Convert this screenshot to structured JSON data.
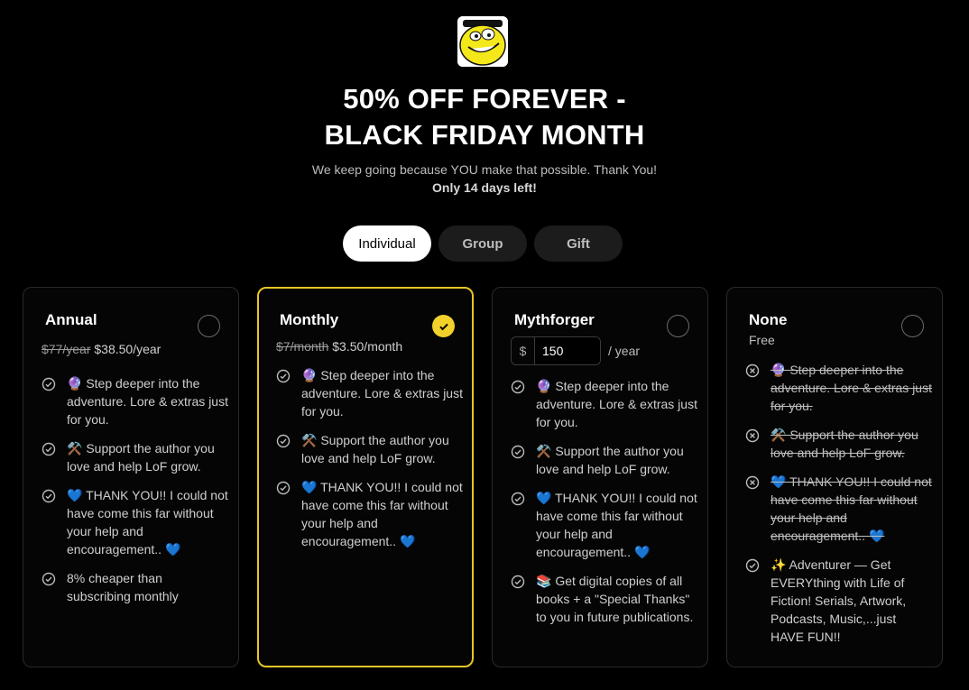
{
  "header": {
    "title_line1": "50% OFF FOREVER -",
    "title_line2": "BLACK FRIDAY MONTH",
    "subtitle": "We keep going because YOU make that possible. Thank You!",
    "urgency": "Only 14 days left!"
  },
  "tabs": [
    {
      "label": "Individual",
      "active": true
    },
    {
      "label": "Group",
      "active": false
    },
    {
      "label": "Gift",
      "active": false
    }
  ],
  "plans": {
    "annual": {
      "name": "Annual",
      "old_price": "$77/year",
      "price": "$38.50/year",
      "selected": false,
      "features": [
        "🔮 Step deeper into the adventure. Lore & extras just for you.",
        "⚒️ Support the author you love and help LoF grow.",
        "💙 THANK YOU!! I could not have come this far without your help and encouragement.. 💙",
        "8% cheaper than subscribing monthly"
      ]
    },
    "monthly": {
      "name": "Monthly",
      "old_price": "$7/month",
      "price": "$3.50/month",
      "selected": true,
      "features": [
        "🔮 Step deeper into the adventure. Lore & extras just for you.",
        "⚒️ Support the author you love and help LoF grow.",
        "💙 THANK YOU!! I could not have come this far without your help and encouragement.. 💙"
      ]
    },
    "mythforger": {
      "name": "Mythforger",
      "currency": "$",
      "amount": "150",
      "unit": "/ year",
      "selected": false,
      "features": [
        "🔮 Step deeper into the adventure. Lore & extras just for you.",
        "⚒️ Support the author you love and help LoF grow.",
        "💙 THANK YOU!! I could not have come this far without your help and encouragement.. 💙",
        "📚 Get digital copies of all books + a \"Special Thanks\" to you in future publications."
      ]
    },
    "none": {
      "name": "None",
      "price": "Free",
      "selected": false,
      "features": [
        "🔮 Step deeper into the adventure. Lore & extras just for you.",
        "⚒️ Support the author you love and help LoF grow.",
        "💙 THANK YOU!! I could not have come this far without your help and encouragement.. 💙",
        "✨ Adventurer — Get EVERYthing with Life of Fiction! Serials, Artwork, Podcasts, Music,...just HAVE FUN!!"
      ]
    }
  },
  "colors": {
    "accent": "#f2d22a",
    "selected_border": "#e6c628",
    "background": "#000000"
  },
  "icons": {
    "logo": "smiling-yellow-face-logo",
    "included": "check-circle-icon",
    "excluded": "x-circle-icon",
    "selected": "check-icon"
  }
}
